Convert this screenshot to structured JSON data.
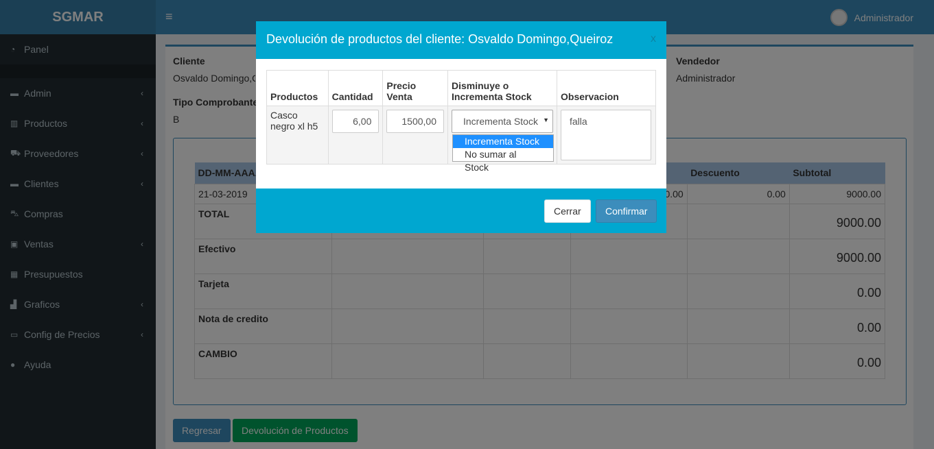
{
  "app": {
    "logo": "SGMAR",
    "user": "Administrador"
  },
  "sidebar": {
    "items": [
      {
        "label": "Panel",
        "icon": "dashboard-icon",
        "chevron": false
      },
      {
        "label": "Admin",
        "icon": "folder-icon",
        "chevron": true
      },
      {
        "label": "Productos",
        "icon": "barcode-icon",
        "chevron": true
      },
      {
        "label": "Proveedores",
        "icon": "truck-icon",
        "chevron": true
      },
      {
        "label": "Clientes",
        "icon": "folder-icon",
        "chevron": true
      },
      {
        "label": "Compras",
        "icon": "cart-icon",
        "chevron": false
      },
      {
        "label": "Ventas",
        "icon": "money-icon",
        "chevron": true
      },
      {
        "label": "Presupuestos",
        "icon": "calculator-icon",
        "chevron": false
      },
      {
        "label": "Graficos",
        "icon": "bar-chart-icon",
        "chevron": true
      },
      {
        "label": "Config de Precios",
        "icon": "laptop-icon",
        "chevron": true
      },
      {
        "label": "Ayuda",
        "icon": "info-icon",
        "chevron": false
      }
    ]
  },
  "main": {
    "cliente_label": "Cliente",
    "cliente_value": "Osvaldo Domingo,Queiroz",
    "vendedor_label": "Vendedor",
    "vendedor_value": "Administrador",
    "tipo_label": "Tipo Comprobante",
    "tipo_value": "B",
    "table": {
      "headers": [
        "DD-MM-AAAA",
        "",
        "",
        "",
        "Descuento",
        "Subtotal"
      ],
      "row": {
        "date": "21-03-2019",
        "c4": "0.00",
        "descuento": "0.00",
        "subtotal": "9000.00"
      },
      "totals": [
        {
          "label": "TOTAL",
          "value": "9000.00"
        },
        {
          "label": "Efectivo",
          "value": "9000.00"
        },
        {
          "label": "Tarjeta",
          "value": "0.00"
        },
        {
          "label": "Nota de credito",
          "value": "0.00"
        },
        {
          "label": "CAMBIO",
          "value": "0.00"
        }
      ]
    },
    "btn_regresar": "Regresar",
    "btn_devolucion": "Devolución de Productos"
  },
  "modal": {
    "title": "Devolución de productos del cliente: Osvaldo Domingo,Queiroz",
    "close": "x",
    "headers": [
      "Productos",
      "Cantidad",
      "Precio Venta",
      "Disminuye o Incrementa Stock",
      "Observacion"
    ],
    "row": {
      "producto": "Casco negro xl h5",
      "cantidad": "6,00",
      "precio": "1500,00",
      "stock_selected": "Incrementa Stock",
      "stock_options": [
        "Incrementa Stock",
        "No sumar al Stock"
      ],
      "observacion": "falla"
    },
    "btn_cerrar": "Cerrar",
    "btn_confirmar": "Confirmar"
  },
  "colors": {
    "header": "#3c8dbc",
    "sidebar": "#222d32",
    "modal_accent": "#00a7d0",
    "success": "#00a65a"
  }
}
